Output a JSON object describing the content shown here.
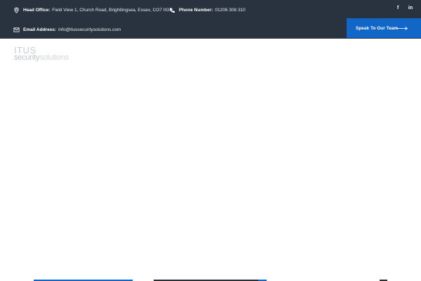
{
  "topbar": {
    "head_office": {
      "label": "Head Office:",
      "value": "Field View 1, Church Road, Brightlingsea, Essex, CO7 0GG",
      "icon": "map-pin-icon"
    },
    "phone": {
      "label": "Phone Number:",
      "value": "01206 308 310",
      "icon": "phone-icon"
    },
    "email": {
      "label": "Email Address:",
      "value": "info@itussecuritysolutions.com",
      "icon": "envelope-icon"
    },
    "social": {
      "facebook": "f",
      "linkedin": "in"
    },
    "cta_label": "Speak To Our Team"
  },
  "logo": {
    "line1": "ITUS",
    "line2_part1": "security",
    "line2_part2": "solutions"
  },
  "colors": {
    "topbar_bg": "#29333f",
    "accent": "#1167c7",
    "logo_text": "#c8ccd1"
  }
}
